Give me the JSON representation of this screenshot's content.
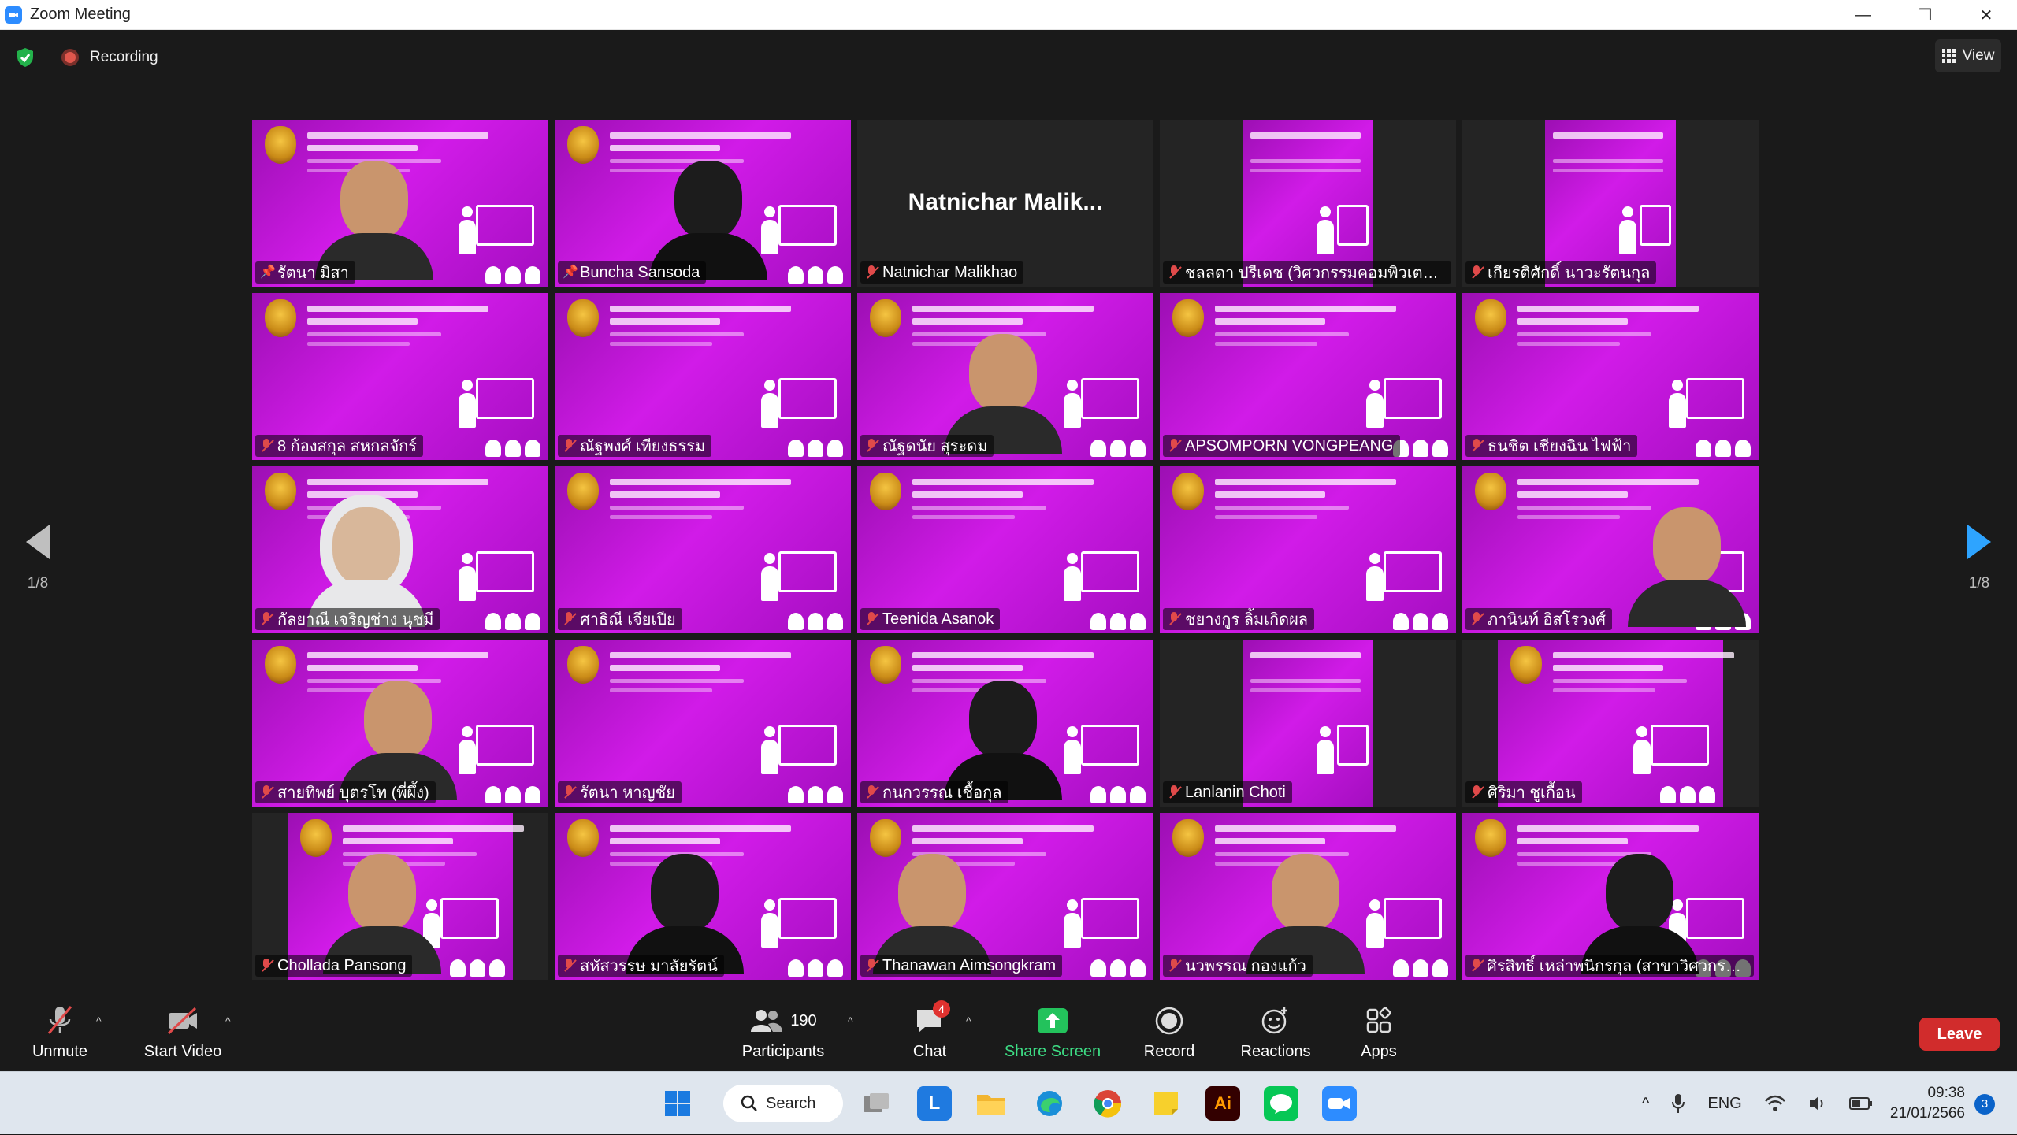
{
  "window": {
    "title": "Zoom Meeting",
    "minimize": "—",
    "restore": "❐",
    "close": "✕"
  },
  "meeting": {
    "recording_label": "Recording",
    "view_label": "View",
    "page_left": "1/8",
    "page_right": "1/8"
  },
  "tiles": [
    {
      "name": "รัตนา มิสา",
      "pinned": true
    },
    {
      "name": "Buncha Sansoda",
      "pinned": true
    },
    {
      "name": "Natnichar Malikhao",
      "big_name": "Natnichar  Malik..."
    },
    {
      "name": "ชลลดา ปรีเดช (วิศวกรรมคอมพิวเตอร์)"
    },
    {
      "name": "เกียรติศักดิ์ นาวะรัตนกุล"
    },
    {
      "name": "8 ก้องสกุล สหกลจักร์"
    },
    {
      "name": "ณัฐพงศ์ เทียงธรรม"
    },
    {
      "name": "ณัฐดนัย สุระดม"
    },
    {
      "name": "APSOMPORN VONGPEANG"
    },
    {
      "name": "ธนชิต เชียงฉิน ไฟฟ้า"
    },
    {
      "name": "กัลยาณี เจริญช่าง นุชมี"
    },
    {
      "name": "ศาธิณี เจียเปีย"
    },
    {
      "name": "Teenida Asanok"
    },
    {
      "name": "ชยางกูร ลิ้มเกิดผล"
    },
    {
      "name": "ภานินท์ อิสโรวงศ์"
    },
    {
      "name": "สายทิพย์ บุตรโท (พี่ผึ้ง)"
    },
    {
      "name": "รัตนา หาญชัย"
    },
    {
      "name": "กนกวรรณ เชื้อกุล"
    },
    {
      "name": "Lanlanin Choti"
    },
    {
      "name": "ศิริมา ชูเกื้อน"
    },
    {
      "name": "Chollada Pansong"
    },
    {
      "name": "สหัสวรรษ มาลัยรัตน์"
    },
    {
      "name": "Thanawan Aimsongkram"
    },
    {
      "name": "นวพรรณ กองแก้ว"
    },
    {
      "name": "ศิรสิทธิ์ เหล่าพนิกรกุล (สาขาวิศวกรรมเ..."
    }
  ],
  "toolbar": {
    "unmute": "Unmute",
    "start_video": "Start Video",
    "participants_count": "190",
    "participants": "Participants",
    "chat": "Chat",
    "chat_badge": "4",
    "share_screen": "Share Screen",
    "record": "Record",
    "reactions": "Reactions",
    "apps": "Apps",
    "leave": "Leave"
  },
  "taskbar": {
    "search": "Search",
    "language": "ENG",
    "time": "09:38",
    "date": "21/01/2566",
    "notifications": "3",
    "adobe_label": "Ai"
  },
  "colors": {
    "active_speaker_border": "#d8e84a",
    "slide_magenta": "#d11be8",
    "share_green": "#3ddc84",
    "leave_red": "#d12c2c",
    "page_arrow_blue": "#2ea4ff"
  }
}
